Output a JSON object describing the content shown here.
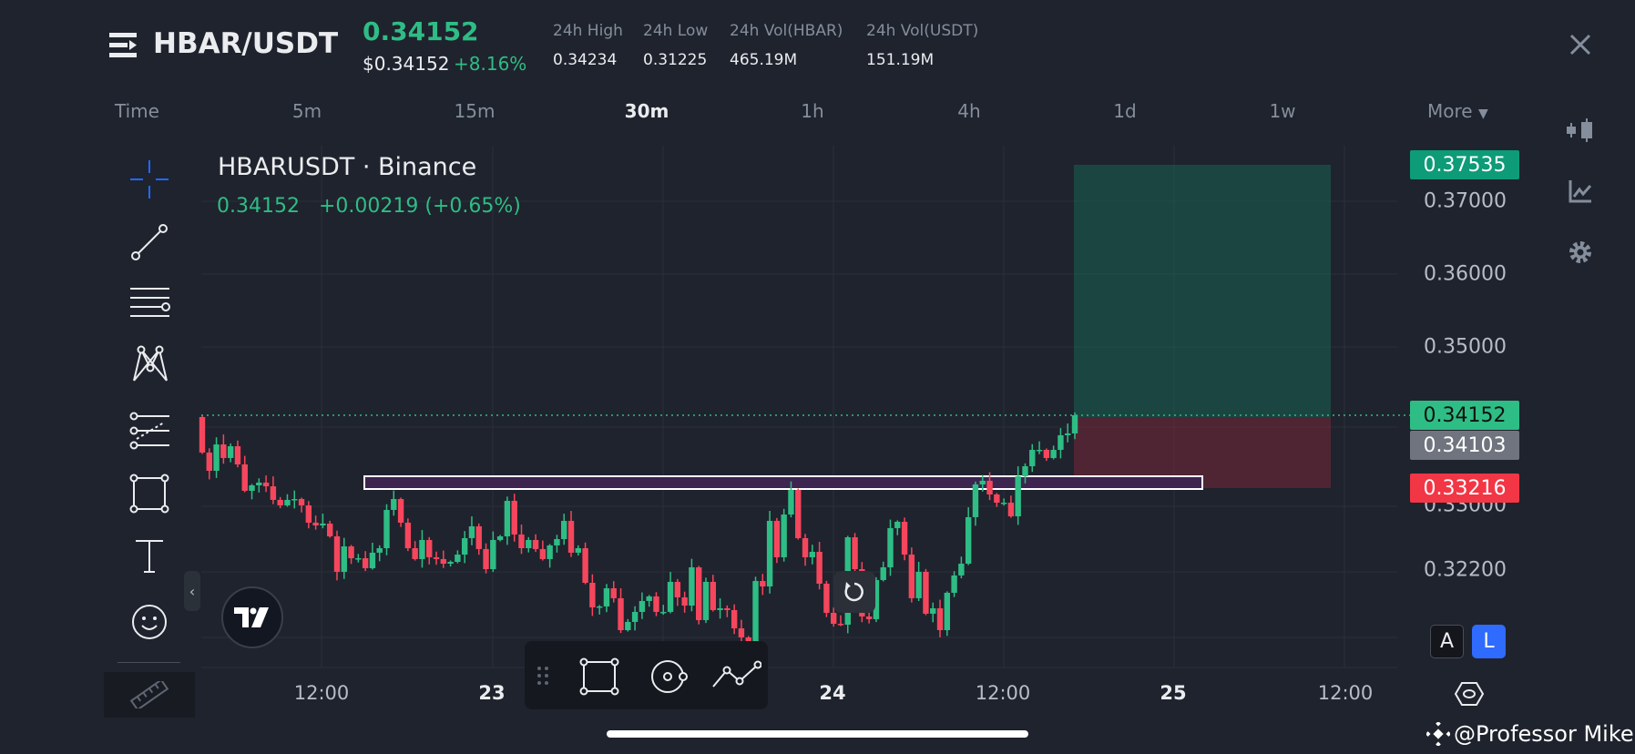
{
  "header": {
    "pair": "HBAR/USDT",
    "last_price": "0.34152",
    "usd_price": "$0.34152",
    "change_pct": "+8.16%",
    "stats": [
      {
        "label": "24h High",
        "value": "0.34234"
      },
      {
        "label": "24h Low",
        "value": "0.31225"
      },
      {
        "label": "24h Vol(HBAR)",
        "value": "465.19M"
      },
      {
        "label": "24h Vol(USDT)",
        "value": "151.19M"
      }
    ]
  },
  "timeframes": {
    "time_label": "Time",
    "items": [
      "5m",
      "15m",
      "30m",
      "1h",
      "4h",
      "1d",
      "1w"
    ],
    "active": "30m",
    "more_label": "More"
  },
  "chart": {
    "title": "HBARUSDT · Binance",
    "last": "0.34152",
    "change": "+0.00219 (+0.65%)",
    "y_ticks": [
      "0.37000",
      "0.36000",
      "0.35000",
      "0.33000",
      "0.32200"
    ],
    "price_tags": {
      "target": "0.37535",
      "current": "0.34152",
      "entry": "0.34103",
      "stop": "0.33216"
    },
    "x_ticks": [
      "12:00",
      "23",
      "24",
      "12:00",
      "25",
      "12:00"
    ],
    "scale_buttons": {
      "auto": "A",
      "log": "L"
    }
  },
  "colors": {
    "up": "#2ebd85",
    "down": "#f6465d",
    "bg": "#1f232d",
    "zone": "#3d2550"
  },
  "watermark": "@Professor Mike",
  "chart_data": {
    "type": "candlestick",
    "interval": "30m",
    "first_open": 0.34129,
    "closes": [
      0.3368,
      0.33449,
      0.33783,
      0.33611,
      0.3376,
      0.3353,
      0.33196,
      0.33265,
      0.333,
      0.33253,
      0.33081,
      0.33012,
      0.33081,
      0.33092,
      0.33012,
      0.32793,
      0.32758,
      0.32781,
      0.3262,
      0.32171,
      0.32493,
      0.32343,
      0.32343,
      0.32217,
      0.32413,
      0.3247,
      0.32954,
      0.33092,
      0.32793,
      0.3247,
      0.32332,
      0.32574,
      0.32355,
      0.32332,
      0.32274,
      0.32297,
      0.32389,
      0.32597,
      0.32747,
      0.32459,
      0.32205,
      0.32574,
      0.3262,
      0.33069,
      0.32643,
      0.3247,
      0.32574,
      0.32459,
      0.32332,
      0.32505,
      0.32585,
      0.32816,
      0.32413,
      0.3247,
      0.32032,
      0.31721,
      0.31733,
      0.31963,
      0.31837,
      0.31433,
      0.31537,
      0.31664,
      0.31802,
      0.3186,
      0.31664,
      0.31664,
      0.32044,
      0.31848,
      0.31744,
      0.32228,
      0.3156,
      0.32044,
      0.31687,
      0.3171,
      0.31687,
      0.31456,
      0.31341,
      0.31295,
      0.32055,
      0.31986,
      0.32816,
      0.32355,
      0.32896,
      0.33207,
      0.32597,
      0.32355,
      0.32424,
      0.32021,
      0.31652,
      0.31514,
      0.31502,
      0.32608,
      0.32205,
      0.31606,
      0.31572,
      0.32067,
      0.32228,
      0.32724,
      0.32804,
      0.32389,
      0.31837,
      0.32171,
      0.31641,
      0.3171,
      0.31433,
      0.31906,
      0.32125,
      0.32274,
      0.32862,
      0.33277,
      0.33323,
      0.3315,
      0.33046,
      0.33046,
      0.32873,
      0.3338,
      0.33507,
      0.33714,
      0.33714,
      0.33611,
      0.33714,
      0.33899,
      0.33922,
      0.34152
    ],
    "resistance_zone": [
      0.33,
      0.3318
    ],
    "long_position": {
      "entry": 0.34103,
      "target": 0.37535,
      "stop": 0.33216
    }
  }
}
